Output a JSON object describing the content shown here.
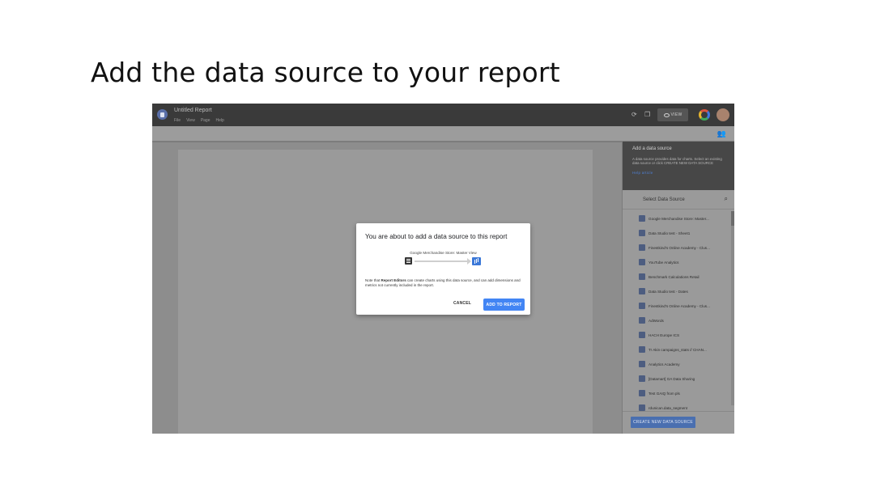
{
  "slide": {
    "title": "Add the data source to your report"
  },
  "app": {
    "report_title": "Untitled Report",
    "menu": [
      "File",
      "View",
      "Page",
      "Help"
    ],
    "view_label": "VIEW",
    "icons": [
      "refresh-icon",
      "copy-icon",
      "eye-icon",
      "google-icon",
      "avatar",
      "add-person-icon",
      "search-icon"
    ]
  },
  "panel": {
    "info_title": "Add a data source",
    "info_text": "A data source provides data for charts. Select an existing data source or click CREATE NEW DATA SOURCE",
    "info_link": "Help article",
    "heading": "Select Data Source",
    "items": [
      "Google Merchandise Store: Master...",
      "Data Studio test - Sheet1",
      "Finestkind's Online Academy - Clus...",
      "YouTube Analytics",
      "Benchmark Calculations Retail",
      "Data Studio test - Dates",
      "Finestkind's Online Academy - Clus...",
      "AdWords",
      "HACH Europe ICS",
      "Tr Akin campaigns_stats // CHAN...",
      "Analytics Academy",
      "[Datamart] GA Data Sharing",
      "Test GAIQ from pls",
      "rdunican.data_segment"
    ],
    "create_label": "CREATE NEW DATA SOURCE"
  },
  "dialog": {
    "title": "You are about to add a data source to this report",
    "source_name": "Google Merchandise Store: Master View",
    "note_prefix": "Note that ",
    "note_bold": "Report Editors",
    "note_suffix": " can create charts using this data source, and can add dimensions and metrics not currently included in the report.",
    "cancel_label": "CANCEL",
    "add_label": "ADD TO REPORT"
  },
  "colors": {
    "accent": "#4285f4",
    "topbar": "#3a3a3a",
    "overlay": "#8f8f8f"
  }
}
